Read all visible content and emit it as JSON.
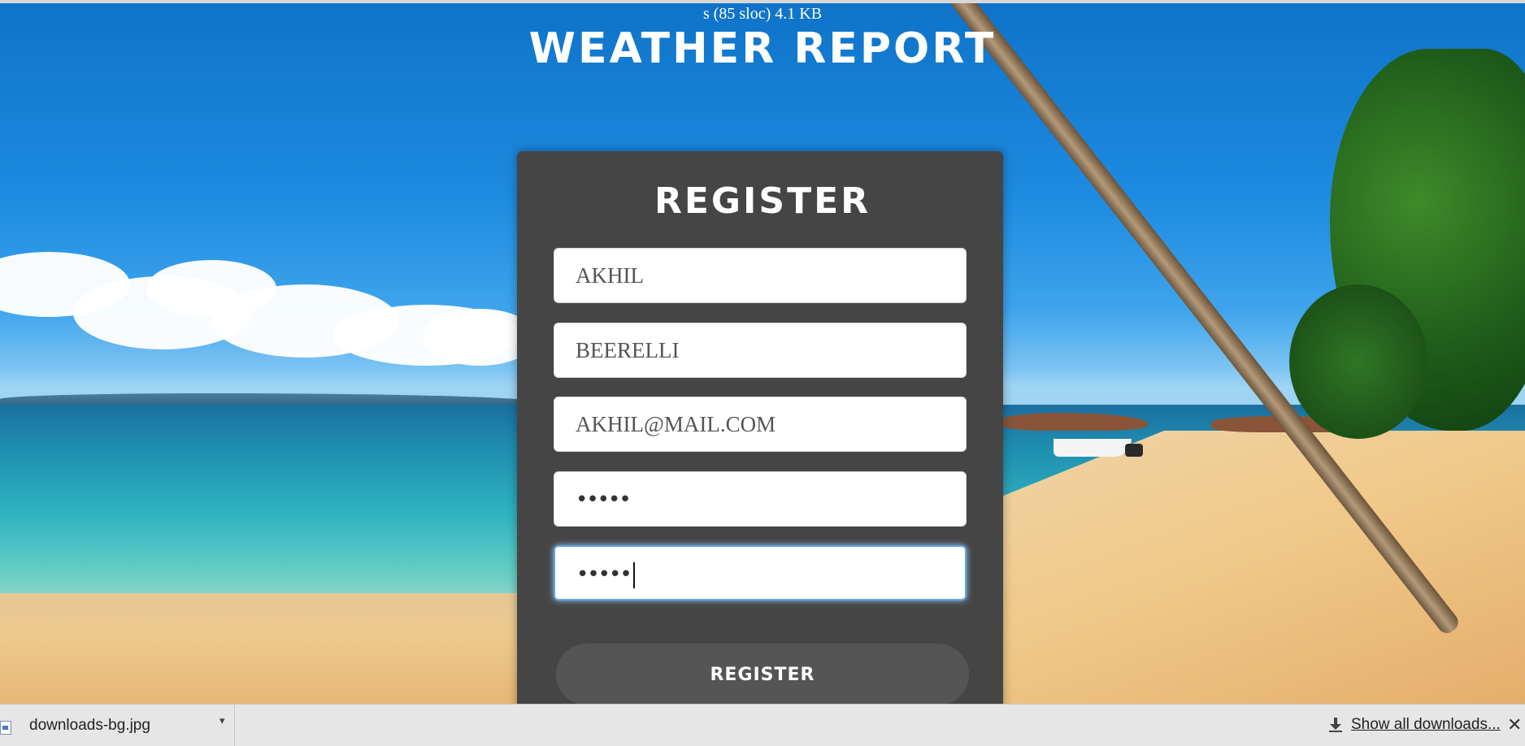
{
  "header": {
    "file_info": "s (85 sloc) 4.1 KB",
    "title": "WEATHER REPORT"
  },
  "form": {
    "title": "REGISTER",
    "first_name_value": "AKHIL",
    "last_name_value": "BEERELLI",
    "email_value": "AKHIL@MAIL.COM",
    "password_mask": "•••••",
    "confirm_password_mask": "•••••",
    "submit_label": "REGISTER"
  },
  "downloads_bar": {
    "file_name": "downloads-bg.jpg",
    "show_all_label": "Show all downloads...",
    "close_glyph": "✕",
    "menu_glyph": "▾"
  },
  "colors": {
    "card_bg": "#454545",
    "button_bg": "#555555",
    "focus_ring": "#5fa5e6"
  }
}
